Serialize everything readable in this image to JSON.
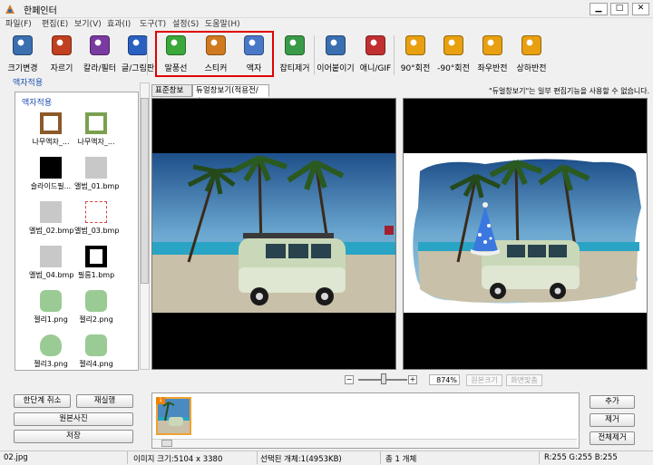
{
  "window": {
    "title": "한페인터",
    "controls": {
      "minimize": "▁",
      "maximize": "□",
      "close": "✕"
    }
  },
  "menu": [
    "파일(F)",
    "편집(E)",
    "보기(V)",
    "효과(I)",
    "도구(T)",
    "설정(S)",
    "도움말(H)"
  ],
  "toolbar": [
    {
      "label": "크기변경",
      "icon": "resize-icon",
      "color": "#3a6fb0"
    },
    {
      "label": "자르기",
      "icon": "crop-icon",
      "color": "#c04020"
    },
    {
      "label": "칼라/필터",
      "icon": "color-filter-icon",
      "color": "#7a3aa0"
    },
    {
      "label": "글/그림판",
      "icon": "text-draw-icon",
      "color": "#2a60c0"
    },
    {
      "label": "말풍선",
      "icon": "speech-bubble-icon",
      "color": "#3aa83a"
    },
    {
      "label": "스티커",
      "icon": "sticker-icon",
      "color": "#d07a20"
    },
    {
      "label": "액자",
      "icon": "frame-icon",
      "color": "#4a78c8"
    },
    {
      "label": "잡티제거",
      "icon": "blemish-remove-icon",
      "color": "#3a9a48"
    },
    {
      "label": "이어붙이기",
      "icon": "merge-icon",
      "color": "#3a6fb0"
    },
    {
      "label": "애니/GIF",
      "icon": "gif-icon",
      "color": "#c03030"
    },
    {
      "label": "90°회전",
      "icon": "rotate-right-icon",
      "color": "#e8a010"
    },
    {
      "label": "-90°회전",
      "icon": "rotate-left-icon",
      "color": "#e8a010"
    },
    {
      "label": "좌우반전",
      "icon": "flip-horizontal-icon",
      "color": "#e8a010"
    },
    {
      "label": "상하반전",
      "icon": "flip-vertical-icon",
      "color": "#e8a010"
    }
  ],
  "left_panel": {
    "title": "액자적용",
    "subtitle": "액자적용",
    "items": [
      {
        "label": "나무액자_...",
        "style": "wood-frame"
      },
      {
        "label": "나무액자_...",
        "style": "green-frame"
      },
      {
        "label": "슬라이드필...",
        "style": "black"
      },
      {
        "label": "앨범_01.bmp",
        "style": "gray"
      },
      {
        "label": "앨범_02.bmp",
        "style": "gray"
      },
      {
        "label": "앨범_03.bmp",
        "style": "red-dotted"
      },
      {
        "label": "앨범_04.bmp",
        "style": "gray"
      },
      {
        "label": "필름1.bmp",
        "style": "film"
      },
      {
        "label": "젤리1.png",
        "style": "jelly"
      },
      {
        "label": "젤리2.png",
        "style": "jelly"
      },
      {
        "label": "젤리3.png",
        "style": "jelly-heart"
      },
      {
        "label": "젤리4.png",
        "style": "jelly"
      }
    ]
  },
  "tabs": [
    {
      "label": "표준창보기"
    },
    {
      "label": "듀얼창보기(적용전/후)"
    }
  ],
  "notice": "\"듀얼창보기\"는 일부 편집기능을 사용할 수 없습니다.",
  "zoom": {
    "minus": "−",
    "plus": "+",
    "percent": "874%",
    "original_size": "원본크기",
    "fit_screen": "화면맞춤",
    "slider_level": 0.5
  },
  "buttons": {
    "undo": "한단계 취소",
    "redo": "재실행",
    "original": "원본사진",
    "save": "저장",
    "add": "추가",
    "remove": "제거",
    "remove_all": "전체제거"
  },
  "filmstrip": {
    "badge": "1"
  },
  "status": {
    "filename": "02.jpg",
    "image_size": "이미지 크기:5104 x 3380",
    "selected": "선택된 개체:1(4953KB)",
    "total": "총 1 개체",
    "color": "R:255 G:255 B:255"
  },
  "colors": {
    "highlight": "#e00000",
    "link_blue": "#2050b0"
  }
}
